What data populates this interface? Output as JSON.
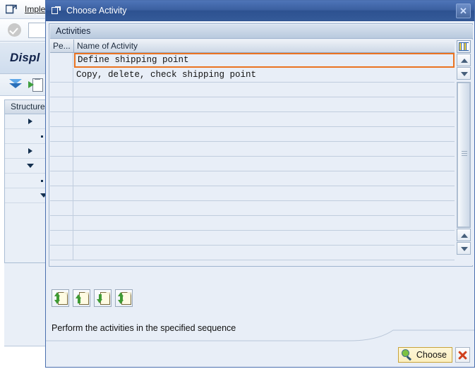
{
  "background_window": {
    "menu": {
      "icon": "exit-arrow-icon",
      "items": [
        {
          "label": "Imple"
        }
      ]
    },
    "toolbar": {
      "confirm_icon": "green-check-icon",
      "command_field_value": ""
    },
    "page_title": "Displ",
    "icon_toolbar": [
      {
        "name": "collapse-all-icon",
        "label": "collapse-all"
      },
      {
        "name": "expand-node-icon",
        "label": "expand-node"
      }
    ],
    "structure_panel": {
      "header": "Structure"
    }
  },
  "dialog": {
    "title": "Choose Activity",
    "title_icon": "window-restore-icon",
    "close_icon": "close-icon",
    "group_title": "Activities",
    "table": {
      "columns": [
        {
          "key": "performed",
          "label": "Pe..."
        },
        {
          "key": "name",
          "label": "Name of Activity"
        }
      ],
      "rows": [
        {
          "performed": "",
          "name": "Define shipping point",
          "selected": true
        },
        {
          "performed": "",
          "name": "Copy, delete, check shipping point",
          "selected": false
        },
        {
          "performed": "",
          "name": "",
          "selected": false
        },
        {
          "performed": "",
          "name": "",
          "selected": false
        },
        {
          "performed": "",
          "name": "",
          "selected": false
        },
        {
          "performed": "",
          "name": "",
          "selected": false
        },
        {
          "performed": "",
          "name": "",
          "selected": false
        },
        {
          "performed": "",
          "name": "",
          "selected": false
        },
        {
          "performed": "",
          "name": "",
          "selected": false
        },
        {
          "performed": "",
          "name": "",
          "selected": false
        },
        {
          "performed": "",
          "name": "",
          "selected": false
        },
        {
          "performed": "",
          "name": "",
          "selected": false
        },
        {
          "performed": "",
          "name": "",
          "selected": false
        },
        {
          "performed": "",
          "name": "",
          "selected": false
        }
      ],
      "column_config_icon": "column-settings-icon",
      "scrollbar": {
        "top_up_icon": "scroll-up-icon",
        "top_down_icon": "scroll-down-icon",
        "bottom_up_icon": "scroll-up-icon",
        "bottom_down_icon": "scroll-down-icon"
      }
    },
    "sequence_toolbar": [
      {
        "name": "move-first-icon",
        "label": "First activity"
      },
      {
        "name": "move-up-icon",
        "label": "Previous activity"
      },
      {
        "name": "move-down-icon",
        "label": "Next activity"
      },
      {
        "name": "move-last-icon",
        "label": "Last activity"
      }
    ],
    "hint": "Perform the activities in the specified sequence",
    "actions": {
      "choose_label": "Choose",
      "choose_icon": "magnifier-icon",
      "cancel_icon": "cancel-x-icon"
    }
  },
  "colors": {
    "dialog_title_bar": "#3a5f9f",
    "selection_outline": "#ea7321",
    "panel_background": "#e8eef7",
    "grid_line": "#c0cdde",
    "button_yellow": "#fbefbf",
    "cancel_red": "#d0401d"
  }
}
